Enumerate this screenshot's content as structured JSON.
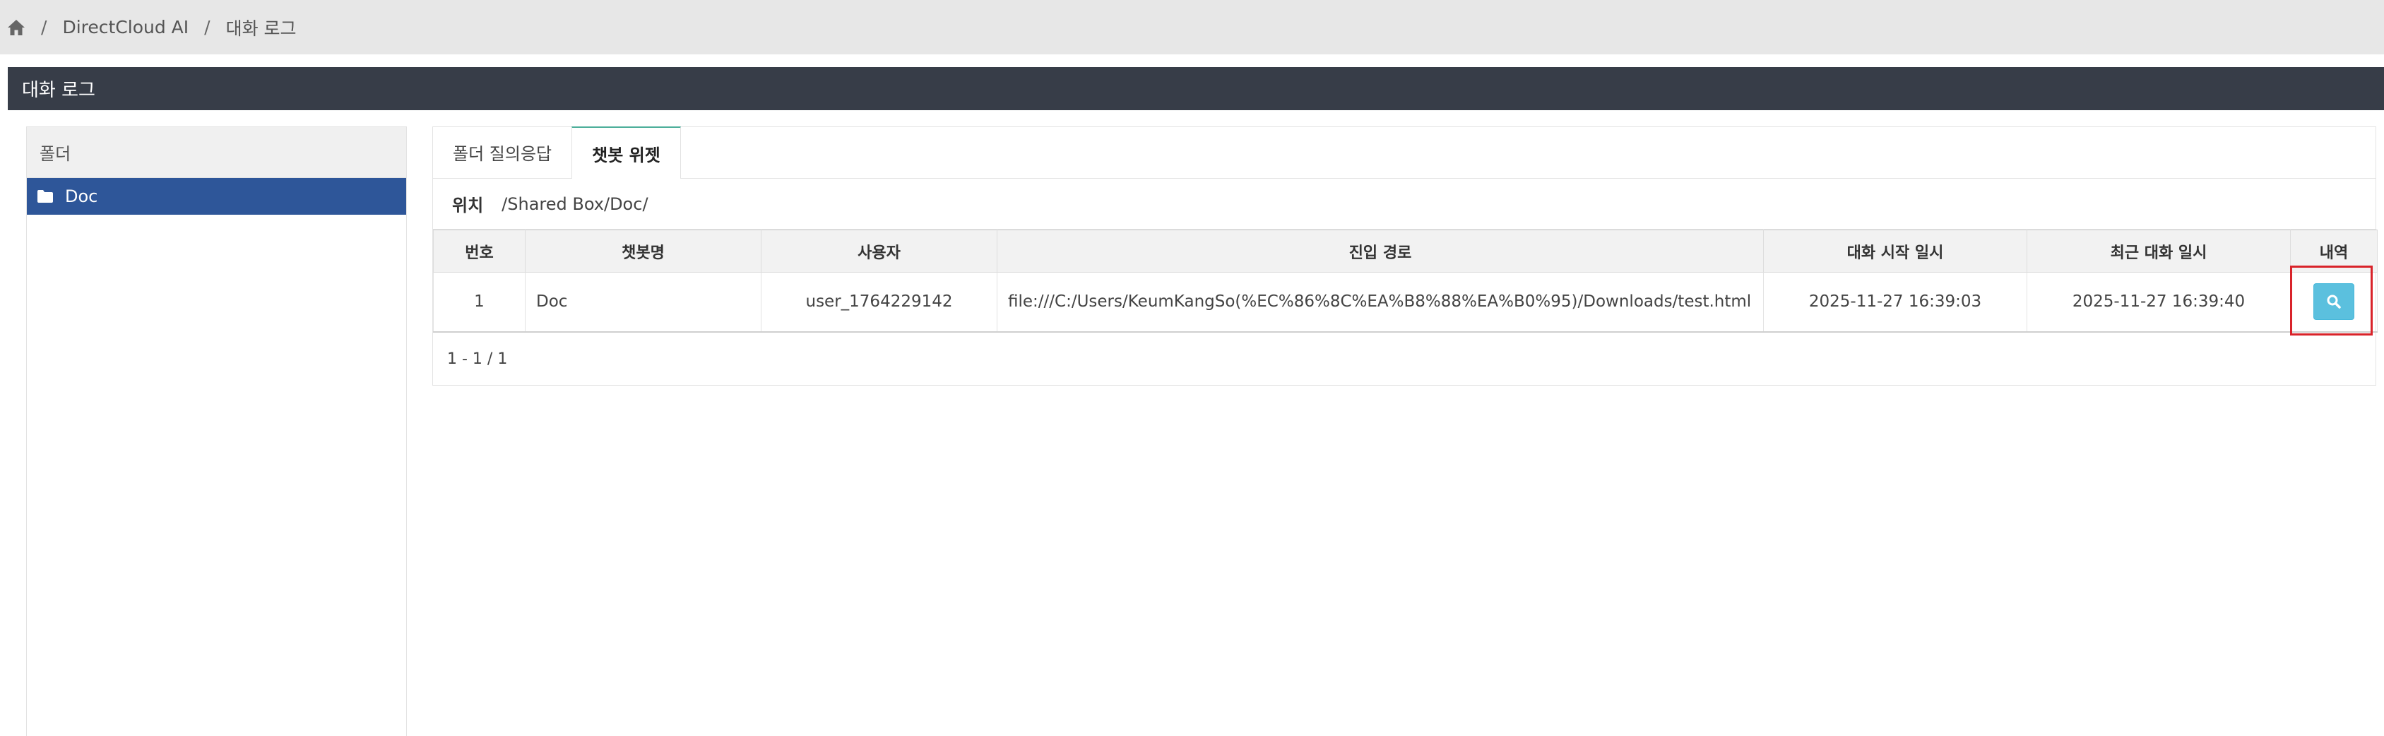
{
  "breadcrumb": {
    "home_icon": "home-icon",
    "separator": "/",
    "items": [
      "DirectCloud AI",
      "대화 로그"
    ]
  },
  "section_title": "대화 로그",
  "folder_panel": {
    "header": "폴더",
    "items": [
      {
        "label": "Doc",
        "icon": "folder-icon",
        "selected": true
      }
    ]
  },
  "tabs": [
    {
      "label": "폴더 질의응답",
      "active": false
    },
    {
      "label": "챗봇 위젯",
      "active": true
    }
  ],
  "location": {
    "label": "위치",
    "value": "/Shared Box/Doc/"
  },
  "table": {
    "columns": [
      "번호",
      "챗봇명",
      "사용자",
      "진입 경로",
      "대화 시작 일시",
      "최근 대화 일시",
      "내역"
    ],
    "rows": [
      {
        "no": "1",
        "chatbot": "Doc",
        "user": "user_1764229142",
        "entry_path": "file:///C:/Users/KeumKangSo(%EC%86%8C%EA%B8%88%EA%B0%95)/Downloads/test.html",
        "started": "2025-11-27 16:39:03",
        "latest": "2025-11-27 16:39:40",
        "action_icon": "search-icon"
      }
    ]
  },
  "pager": "1 - 1 / 1",
  "colors": {
    "title_bar": "#373d48",
    "selected_folder": "#2e5699",
    "search_button": "#5bc0de",
    "highlight": "#d9232a"
  }
}
